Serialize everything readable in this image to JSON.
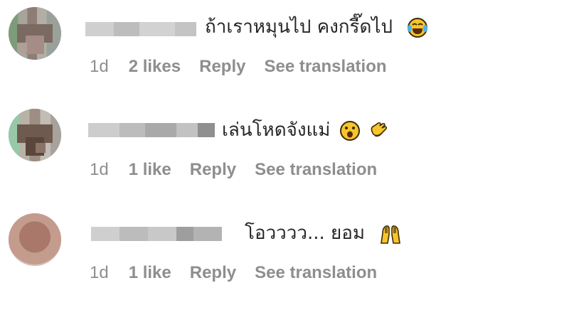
{
  "comments": [
    {
      "text": "ถ้าเราหมุนไป คงกรี๊ดไป",
      "emoji": [
        "face-with-tears-of-joy-icon"
      ],
      "time": "1d",
      "likes": "2 likes",
      "reply": "Reply",
      "see_translation": "See translation"
    },
    {
      "text": "เล่นโหดจังแม่",
      "emoji": [
        "astonished-face-icon",
        "clapping-hands-icon"
      ],
      "time": "1d",
      "likes": "1 like",
      "reply": "Reply",
      "see_translation": "See translation"
    },
    {
      "text": "โอวววว... ยอม",
      "emoji": [
        "raising-hands-icon"
      ],
      "time": "1d",
      "likes": "1 like",
      "reply": "Reply",
      "see_translation": "See translation"
    }
  ],
  "colors": {
    "text": "#262626",
    "meta": "#8e8e8e",
    "emoji_yellow": "#f7c52b",
    "emoji_outline": "#3b2b0a"
  }
}
